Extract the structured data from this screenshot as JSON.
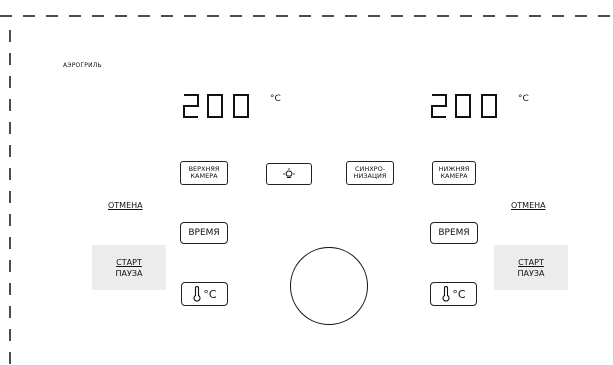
{
  "header": {
    "title": "АЭРОГРИЛЬ"
  },
  "displays": {
    "left": {
      "value": "200",
      "unit": "°C"
    },
    "right": {
      "value": "200",
      "unit": "°C"
    }
  },
  "buttons": {
    "upper_chamber": [
      "ВЕРХНЯЯ",
      "КАМЕРА"
    ],
    "lower_chamber": [
      "НИЖНЯЯ",
      "КАМЕРА"
    ],
    "sync": [
      "СИНХРО-",
      "НИЗАЦИЯ"
    ],
    "cancel_left": "ОТМЕНА",
    "cancel_right": "ОТМЕНА",
    "time_left": "ВРЕМЯ",
    "time_right": "ВРЕМЯ",
    "start_pause_left": [
      "СТАРТ",
      "ПАУЗА"
    ],
    "start_pause_right": [
      "СТАРТ",
      "ПАУЗА"
    ],
    "temp_left": "°C",
    "temp_right": "°C"
  },
  "icons": {
    "light": "lightbulb-icon",
    "thermometer": "thermometer-icon"
  },
  "colors": {
    "panel_bg": "#ececec",
    "line": "#111111"
  }
}
